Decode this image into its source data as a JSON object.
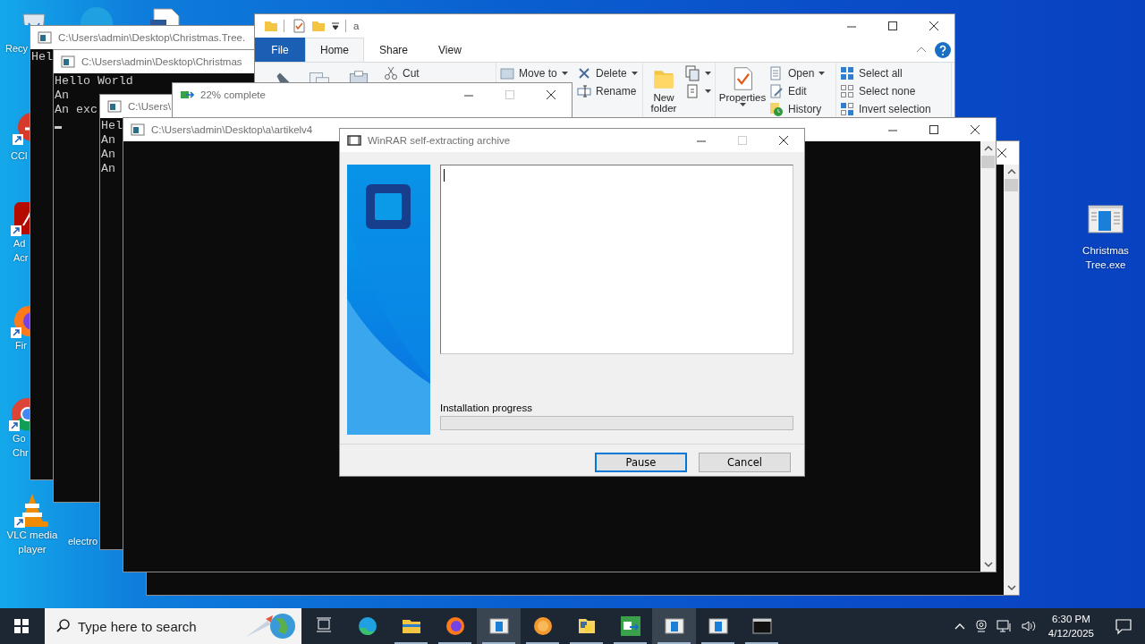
{
  "desktop_icons": [
    {
      "kind": "recycle",
      "lines": [
        "Recy"
      ]
    },
    {
      "kind": "edge"
    },
    {
      "kind": "document"
    },
    {
      "kind": "ccleaner",
      "lines": [
        "CCl"
      ]
    },
    {
      "kind": "acrobat",
      "lines": [
        "Ad",
        "Acr"
      ]
    },
    {
      "kind": "firefox",
      "lines": [
        "Fir"
      ]
    },
    {
      "kind": "chrome",
      "lines": [
        "Go",
        "Chr"
      ]
    },
    {
      "kind": "vlc",
      "lines": [
        "VLC media",
        "player"
      ]
    },
    {
      "kind": "blank",
      "lines": [
        "electro"
      ]
    },
    {
      "kind": "exe",
      "lines": [
        "Christmas",
        "Tree.exe"
      ]
    }
  ],
  "windows": [
    {
      "kind": "console",
      "title": "C:\\Users\\admin\\Desktop\\Christmas.Tree.",
      "lines": [
        "Hel"
      ]
    },
    {
      "kind": "console",
      "title": "C:\\Users\\admin\\Desktop\\Christmas",
      "lines": [
        "Hello World",
        "An",
        "An exc"
      ],
      "cursor": true
    },
    {
      "kind": "explorer",
      "title": "a",
      "tabs": [
        {
          "label": "File",
          "kind": "backstage",
          "selected": false
        },
        {
          "label": "Home",
          "kind": "tab",
          "selected": true
        },
        {
          "label": "Share",
          "kind": "tab",
          "selected": false
        },
        {
          "label": "View",
          "kind": "tab",
          "selected": false
        }
      ],
      "ribbon": [
        {
          "columns": [
            {
              "kind": "large"
            },
            {
              "kind": "large"
            },
            {
              "kind": "large"
            },
            {
              "kind": "small",
              "items": [
                {
                  "label": "Cut"
                }
              ]
            }
          ]
        },
        {
          "columns": [
            {
              "kind": "small",
              "items": [
                {
                  "label": "Move to",
                  "dropdown": true
                }
              ]
            },
            {
              "kind": "small",
              "items": [
                {
                  "label": "Delete",
                  "dropdown": true
                },
                {
                  "label": "Rename"
                }
              ]
            }
          ]
        },
        {
          "columns": [
            {
              "kind": "large",
              "label": "New folder"
            },
            {
              "kind": "small",
              "items": [
                {
                  "dropdown": true
                },
                {
                  "dropdown": true
                }
              ]
            }
          ]
        },
        {
          "columns": [
            {
              "kind": "large",
              "label": "Properties",
              "dropdown": true
            },
            {
              "kind": "small",
              "items": [
                {
                  "label": "Open",
                  "dropdown": true
                },
                {
                  "label": "Edit"
                },
                {
                  "label": "History"
                }
              ]
            }
          ]
        },
        {
          "columns": [
            {
              "kind": "small",
              "items": [
                {
                  "label": "Select all"
                },
                {
                  "label": "Select none"
                },
                {
                  "label": "Invert selection"
                }
              ]
            }
          ]
        }
      ]
    },
    {
      "kind": "console",
      "title": "C:\\Users\\",
      "lines": [
        "Hel",
        "An",
        "An",
        "An"
      ]
    },
    {
      "kind": "console",
      "scrollbar": true
    },
    {
      "kind": "progress",
      "title": "22% complete"
    },
    {
      "kind": "console",
      "title": "C:\\Users\\admin\\Desktop\\a\\artikelv4",
      "scrollbar": true
    },
    {
      "kind": "winrar",
      "title": "WinRAR self-extracting archive",
      "progress_label": "Installation progress",
      "level": 0,
      "buttons": [
        {
          "label": "Pause",
          "default": true
        },
        {
          "label": "Cancel",
          "default": false
        }
      ]
    }
  ],
  "taskbar": {
    "search_placeholder": "Type here to search",
    "apps": [
      {
        "kind": "taskview",
        "open": false,
        "selected": false
      },
      {
        "kind": "edge",
        "open": false,
        "selected": false
      },
      {
        "kind": "explorer",
        "open": true,
        "selected": false
      },
      {
        "kind": "firefox",
        "open": true,
        "selected": false
      },
      {
        "kind": "window",
        "open": true,
        "selected": true
      },
      {
        "kind": "orb",
        "open": true,
        "selected": false
      },
      {
        "kind": "python",
        "open": true,
        "selected": false
      },
      {
        "kind": "copy",
        "open": true,
        "selected": false
      },
      {
        "kind": "window",
        "open": true,
        "selected": true
      },
      {
        "kind": "window",
        "open": true,
        "selected": false
      },
      {
        "kind": "terminal",
        "open": true,
        "selected": false
      }
    ],
    "time": "6:30 PM",
    "date": "4/12/2025"
  }
}
